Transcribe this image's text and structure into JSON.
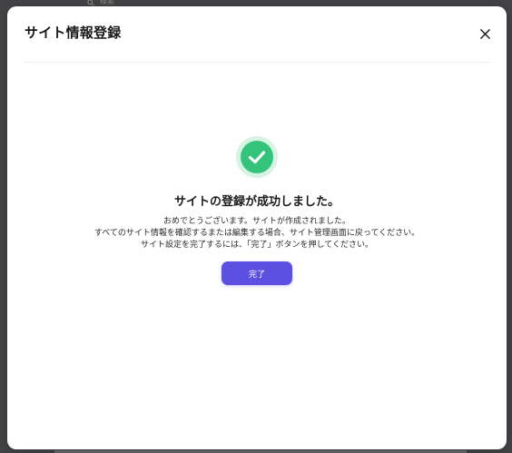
{
  "background": {
    "search_label": "検索"
  },
  "modal": {
    "title": "サイト情報登録",
    "close_label": "×"
  },
  "success": {
    "title": "サイトの登録が成功しました。",
    "message_lines": [
      "おめでとうございます。サイトが作成されました。",
      "すべてのサイト情報を確認するまたは編集する場合、サイト管理画面に戻ってください。",
      "サイト設定を完了するには、「完了」ボタンを押してください。"
    ],
    "done_label": "完了"
  },
  "colors": {
    "success_green": "#33c37a",
    "success_halo": "#d6f3e3",
    "button_primary": "#5b50e0"
  },
  "icons": {
    "success": "check-circle-icon",
    "close": "close-icon",
    "search": "search-icon"
  }
}
